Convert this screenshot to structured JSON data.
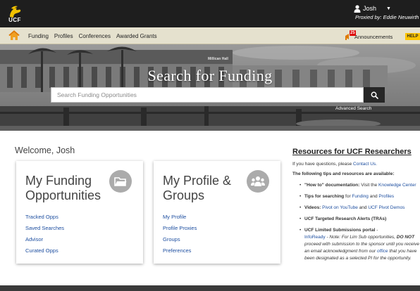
{
  "brand": {
    "logo_text": "UCF"
  },
  "user": {
    "name": "Josh",
    "proxy_text": "Proxied by: Eddie Neuwirth"
  },
  "nav": {
    "links": [
      "Funding",
      "Profiles",
      "Conferences",
      "Awarded Grants"
    ],
    "announcements_label": "Announcements",
    "announcements_count": "25",
    "help_label": "HELP"
  },
  "hero": {
    "title": "Search for Funding",
    "search_placeholder": "Search Funding Opportunities",
    "advanced_search": "Advanced Search",
    "building_sign": "Millican Hall"
  },
  "main": {
    "welcome": "Welcome, Josh",
    "cards": [
      {
        "title": "My Funding Opportunities",
        "icon": "folder-icon",
        "links": [
          "Tracked Opps",
          "Saved Searches",
          "Advisor",
          "Curated Opps"
        ]
      },
      {
        "title": "My Profile & Groups",
        "icon": "people-icon",
        "links": [
          "My Profile",
          "Profile Proxies",
          "Groups",
          "Preferences"
        ]
      }
    ]
  },
  "resources": {
    "title": "Resources for UCF Researchers",
    "questions_prefix": "If you have questions, please ",
    "questions_link": "Contact Us.",
    "tips_intro": "The following tips and resources are available:",
    "howto_bold": "\"How to\" documentation:",
    "howto_text": " Visit the ",
    "howto_link": "Knowledge Center",
    "tips_bold": "Tips for searching",
    "tips_for": " for ",
    "tips_link1": "Funding",
    "tips_and": " and ",
    "tips_link2": "Profiles",
    "videos_bold": "Videos:",
    "videos_link1": "Pivot on YouTube",
    "videos_and": " and ",
    "videos_link2": "UCF Pivot Demos",
    "tras": "UCF Targeted Research Alerts (TRAs)",
    "lim_bold": "UCF Limited Submissions portal",
    "lim_dash": " -",
    "lim_link": "InfoReady",
    "lim_note1": " - Note: For Lim Sub opportunities, ",
    "lim_do_not": "DO NOT",
    "lim_note2": " proceed with submission to the sponsor until you receive an email acknowledgment from our ",
    "lim_office": "office",
    "lim_note3": " that you have been designated as a selected PI for the opportunity."
  },
  "colors": {
    "topbar": "#1e1e1e",
    "navbar": "#e5e1ce",
    "help": "#fdc400",
    "link": "#1e4fa0",
    "badge": "#dd0000"
  }
}
